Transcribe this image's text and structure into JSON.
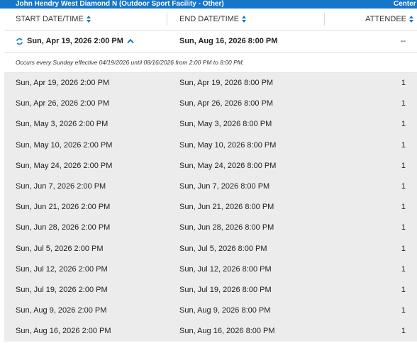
{
  "facility": {
    "title": "John Hendry West Diamond N (Outdoor Sport Facility - Other)",
    "right_label": "Center"
  },
  "columns": {
    "start": "START DATE/TIME",
    "end": "END DATE/TIME",
    "attendee": "ATTENDEE"
  },
  "series": {
    "start": "Sun, Apr 19, 2026 2:00 PM",
    "end": "Sun, Aug 16, 2026 8:00 PM",
    "attendee": "--",
    "note": "Occurs every Sunday effective 04/19/2026 until 08/16/2026 from 2:00 PM to 8:00 PM."
  },
  "occurrences": [
    {
      "start": "Sun, Apr 19, 2026 2:00 PM",
      "end": "Sun, Apr 19, 2026 8:00 PM",
      "attendee": "1"
    },
    {
      "start": "Sun, Apr 26, 2026 2:00 PM",
      "end": "Sun, Apr 26, 2026 8:00 PM",
      "attendee": "1"
    },
    {
      "start": "Sun, May 3, 2026 2:00 PM",
      "end": "Sun, May 3, 2026 8:00 PM",
      "attendee": "1"
    },
    {
      "start": "Sun, May 10, 2026 2:00 PM",
      "end": "Sun, May 10, 2026 8:00 PM",
      "attendee": "1"
    },
    {
      "start": "Sun, May 24, 2026 2:00 PM",
      "end": "Sun, May 24, 2026 8:00 PM",
      "attendee": "1"
    },
    {
      "start": "Sun, Jun 7, 2026 2:00 PM",
      "end": "Sun, Jun 7, 2026 8:00 PM",
      "attendee": "1"
    },
    {
      "start": "Sun, Jun 21, 2026 2:00 PM",
      "end": "Sun, Jun 21, 2026 8:00 PM",
      "attendee": "1"
    },
    {
      "start": "Sun, Jun 28, 2026 2:00 PM",
      "end": "Sun, Jun 28, 2026 8:00 PM",
      "attendee": "1"
    },
    {
      "start": "Sun, Jul 5, 2026 2:00 PM",
      "end": "Sun, Jul 5, 2026 8:00 PM",
      "attendee": "1"
    },
    {
      "start": "Sun, Jul 12, 2026 2:00 PM",
      "end": "Sun, Jul 12, 2026 8:00 PM",
      "attendee": "1"
    },
    {
      "start": "Sun, Jul 19, 2026 2:00 PM",
      "end": "Sun, Jul 19, 2026 8:00 PM",
      "attendee": "1"
    },
    {
      "start": "Sun, Aug 9, 2026 2:00 PM",
      "end": "Sun, Aug 9, 2026 8:00 PM",
      "attendee": "1"
    },
    {
      "start": "Sun, Aug 16, 2026 2:00 PM",
      "end": "Sun, Aug 16, 2026 8:00 PM",
      "attendee": "1"
    }
  ],
  "icons": {
    "repeat": "repeat-icon",
    "collapse": "chevron-up-icon",
    "sort": "sort-icon"
  },
  "colors": {
    "accent": "#1676c9",
    "row_background": "#ececec"
  }
}
